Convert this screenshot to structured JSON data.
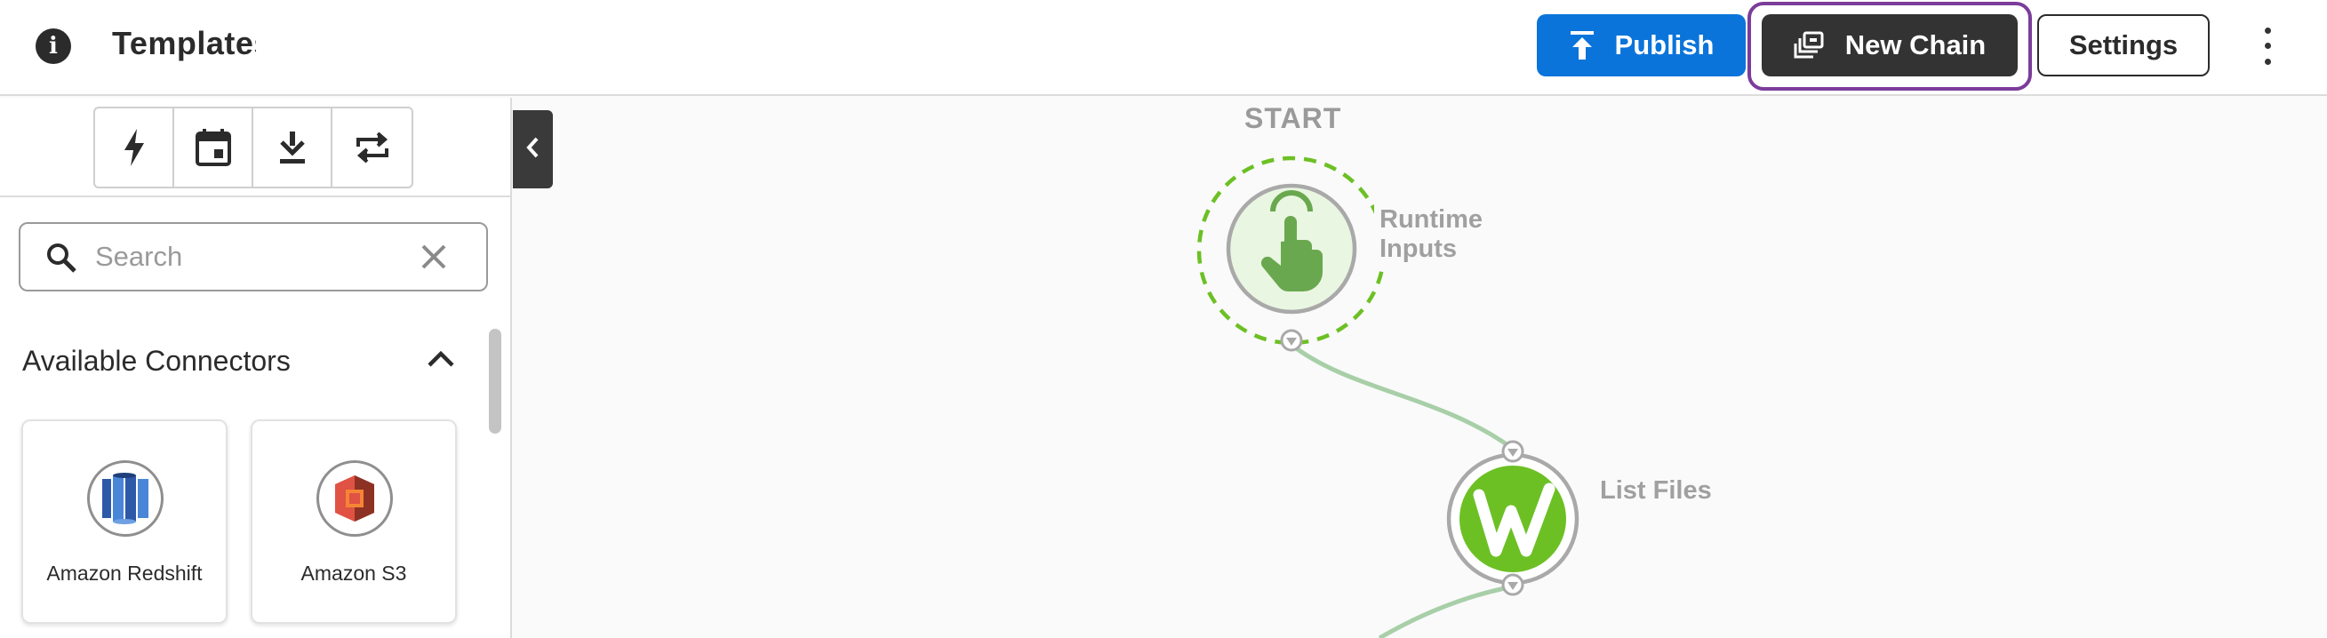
{
  "header": {
    "title": "Templates",
    "publish_label": "Publish",
    "new_chain_label": "New Chain",
    "settings_label": "Settings"
  },
  "sidebar": {
    "toolbar": [
      {
        "name": "bolt-icon"
      },
      {
        "name": "calendar-icon"
      },
      {
        "name": "download-icon"
      },
      {
        "name": "repeat-icon"
      }
    ],
    "search": {
      "value": "",
      "placeholder": "Search"
    },
    "section_title": "Available Connectors",
    "connectors": [
      {
        "label": "Amazon Redshift",
        "icon": "amazon-redshift-icon"
      },
      {
        "label": "Amazon S3",
        "icon": "amazon-s3-icon"
      }
    ]
  },
  "canvas": {
    "start_label": "START",
    "nodes": [
      {
        "label": "Runtime Inputs",
        "icon": "pointer-hand-icon"
      },
      {
        "label": "List Files",
        "icon": "workiva-w-icon"
      }
    ]
  },
  "colors": {
    "publish": "#0a74da",
    "new_chain": "#333333",
    "focus_ring": "#7b3c9a",
    "start_dash": "#6cc024",
    "node_green": "#6cc024",
    "connector_line": "#a8cfa8"
  }
}
